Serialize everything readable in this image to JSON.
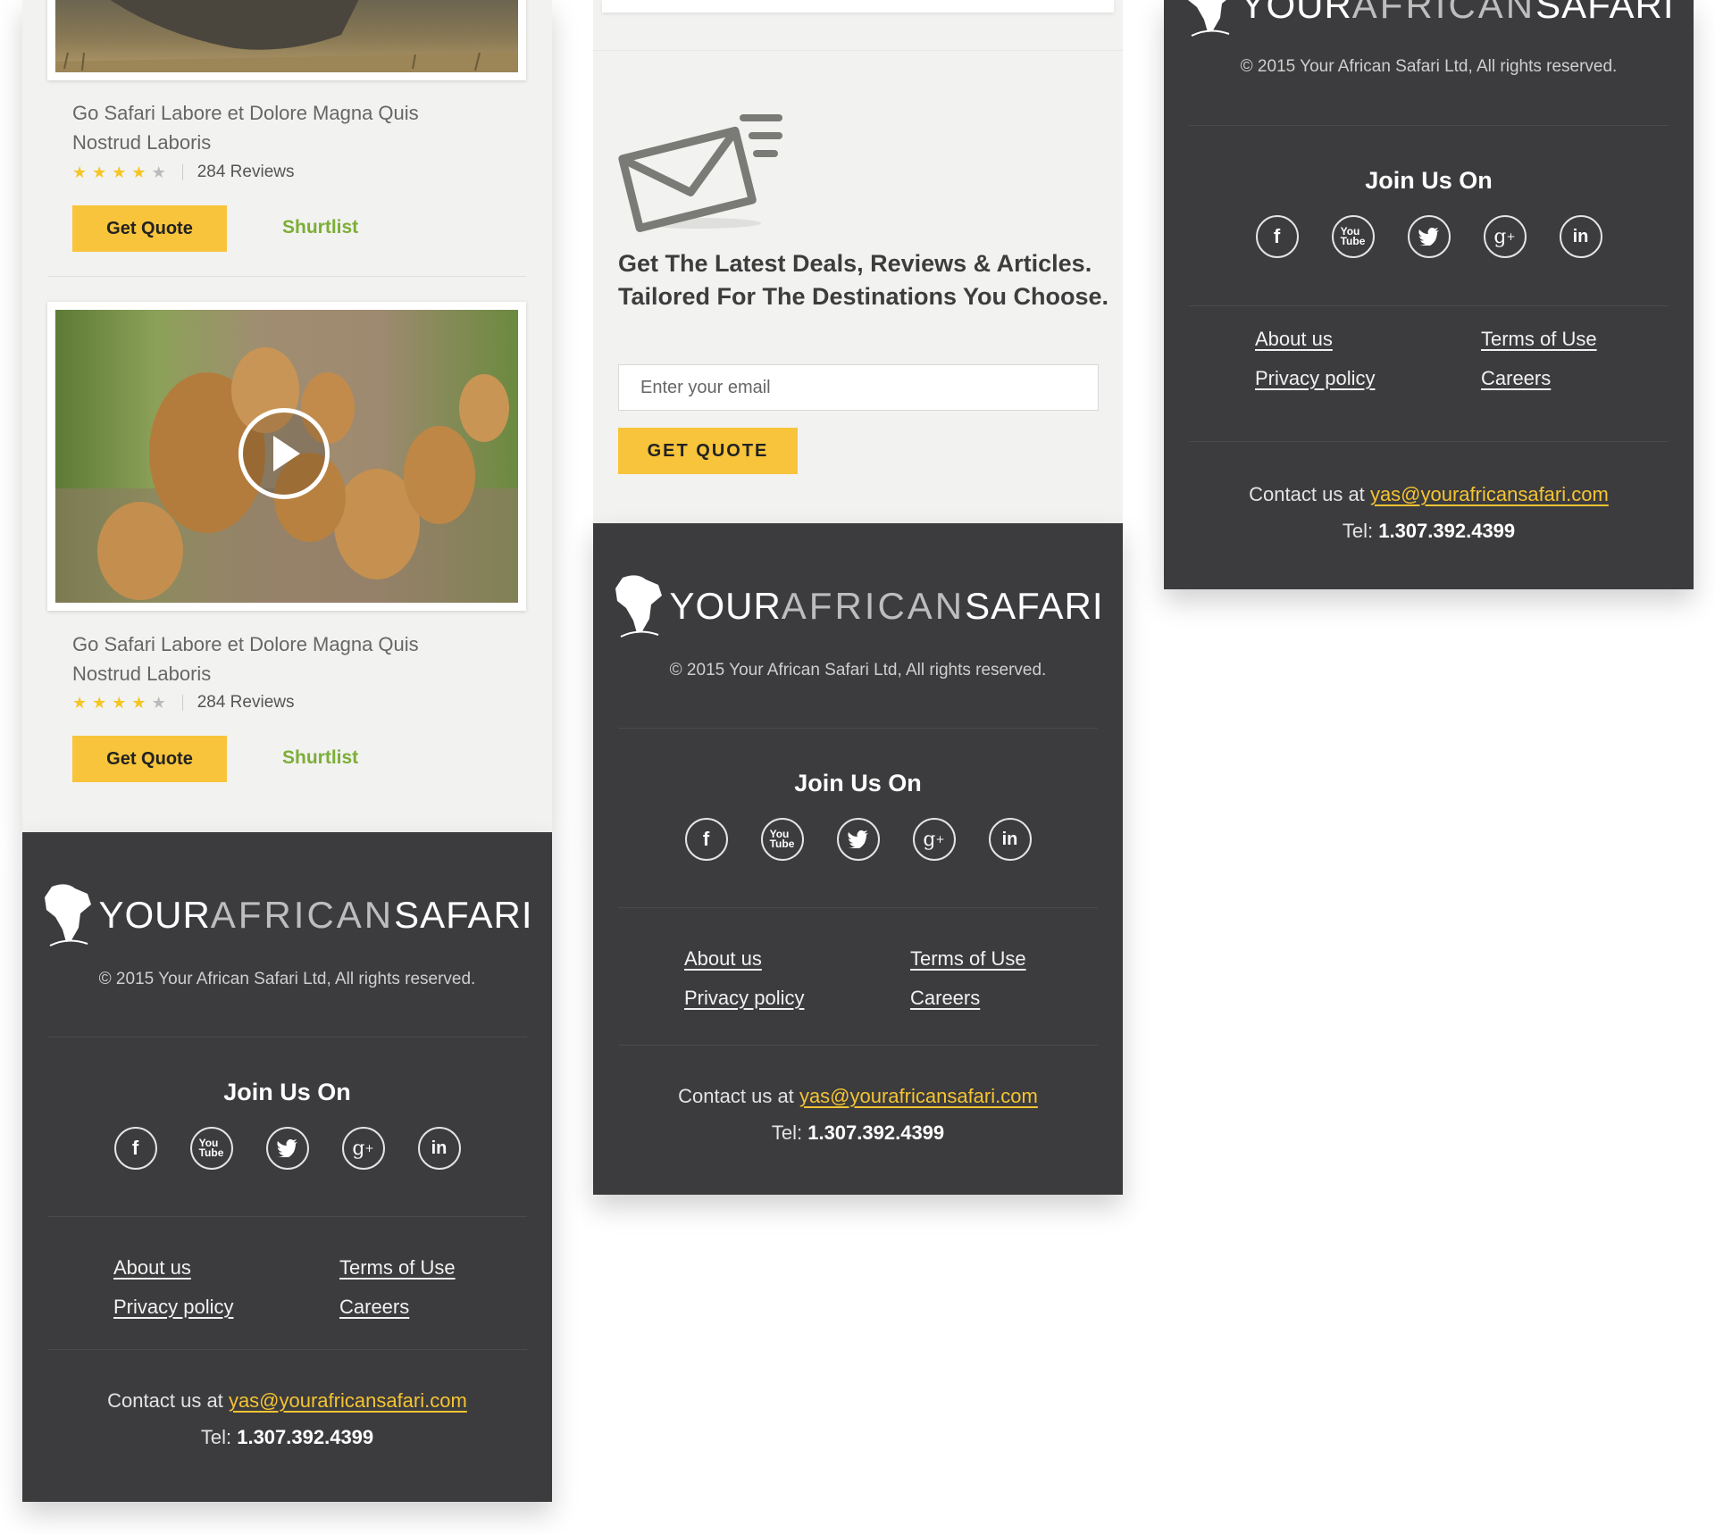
{
  "cards": [
    {
      "title": "Go Safari Labore et Dolore Magna Quis Nostrud Laboris",
      "rating": 4,
      "reviews": "284 Reviews",
      "quote_label": "Get Quote",
      "shortlist_label": "Shurtlist",
      "media": "rhino-photo"
    },
    {
      "title": "Go Safari Labore et Dolore Magna Quis Nostrud Laboris",
      "rating": 4,
      "reviews": "284 Reviews",
      "quote_label": "Get Quote",
      "shortlist_label": "Shurtlist",
      "media": "lions-video"
    }
  ],
  "newsletter": {
    "title": "Get The Latest Deals, Reviews & Articles. Tailored For The Destinations You Choose.",
    "email_placeholder": "Enter your email",
    "button_label": "GET QUOTE",
    "icon": "envelope-icon"
  },
  "footer": {
    "logo": {
      "your": "YOUR",
      "african": "AFRICAN",
      "safari": "SAFARI"
    },
    "copyright": "© 2015 Your African Safari Ltd, All rights reserved.",
    "join_title": "Join Us On",
    "social_icons": [
      "facebook-icon",
      "youtube-icon",
      "twitter-icon",
      "google-plus-icon",
      "linkedin-icon"
    ],
    "links": {
      "about": "About us",
      "terms": "Terms of Use",
      "privacy": "Privacy policy",
      "careers": "Careers"
    },
    "contact_prefix": "Contact us at",
    "email": "yas@yourafricansafari.com",
    "tel_label": "Tel:",
    "tel": "1.307.392.4399"
  },
  "colors": {
    "footer_bg": "#3c3b3d",
    "accent_yellow": "#f8c43b",
    "shortlist_green": "#7cae36",
    "panel_bg": "#f2f2f1"
  }
}
